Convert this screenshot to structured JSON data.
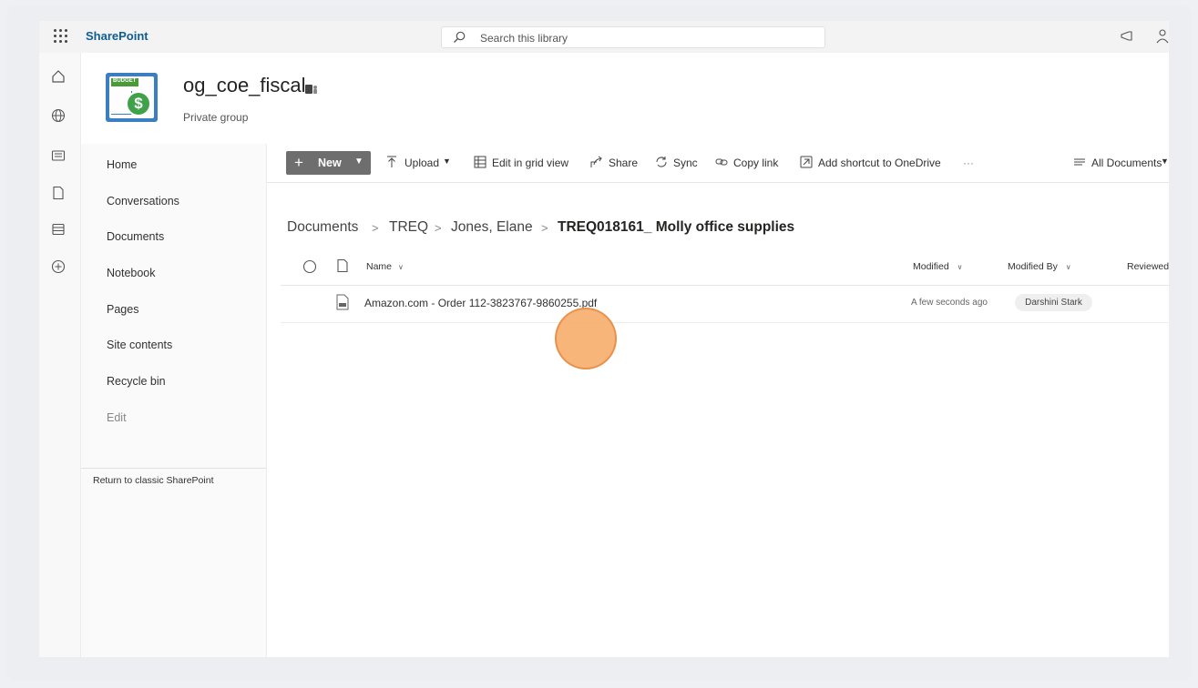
{
  "suite": {
    "app_name": "SharePoint",
    "search_placeholder": "Search this library",
    "icons": [
      "app-launcher-icon",
      "search-icon",
      "megaphone-icon",
      "person-icon"
    ]
  },
  "rail": {
    "icons": [
      "home-icon",
      "globe-icon",
      "news-icon",
      "file-icon",
      "list-icon",
      "add-icon"
    ]
  },
  "site": {
    "title": "og_coe_fiscal",
    "subtitle": "Private group",
    "logo_text": "BUDGET",
    "logo_glyph": "$"
  },
  "nav": {
    "items": [
      "Home",
      "Conversations",
      "Documents",
      "Notebook",
      "Pages",
      "Site contents",
      "Recycle bin",
      "Edit"
    ],
    "classic_link": "Return to classic SharePoint"
  },
  "command_bar": {
    "new_label": "New",
    "upload_label": "Upload",
    "grid_label": "Edit in grid view",
    "share_label": "Share",
    "sync_label": "Sync",
    "copy_link_label": "Copy link",
    "shortcut_label": "Add shortcut to OneDrive",
    "more_label": "···",
    "view_label": "All Documents"
  },
  "breadcrumb": [
    "Documents",
    "TREQ",
    "Jones, Elane",
    "TREQ018161_ Molly office supplies"
  ],
  "breadcrumb_separator": ">",
  "list": {
    "columns": {
      "name": "Name",
      "modified": "Modified",
      "modified_by": "Modified By",
      "reviewed": "Reviewed"
    },
    "rows": [
      {
        "name": "Amazon.com - Order 112-3823767-9860255.pdf",
        "modified": "A few seconds ago",
        "modified_by": "Darshini Stark"
      }
    ]
  },
  "colors": {
    "brand": "#0f5d96",
    "new_button": "#6e6e6e",
    "cursor_highlight": "#f7a863"
  }
}
